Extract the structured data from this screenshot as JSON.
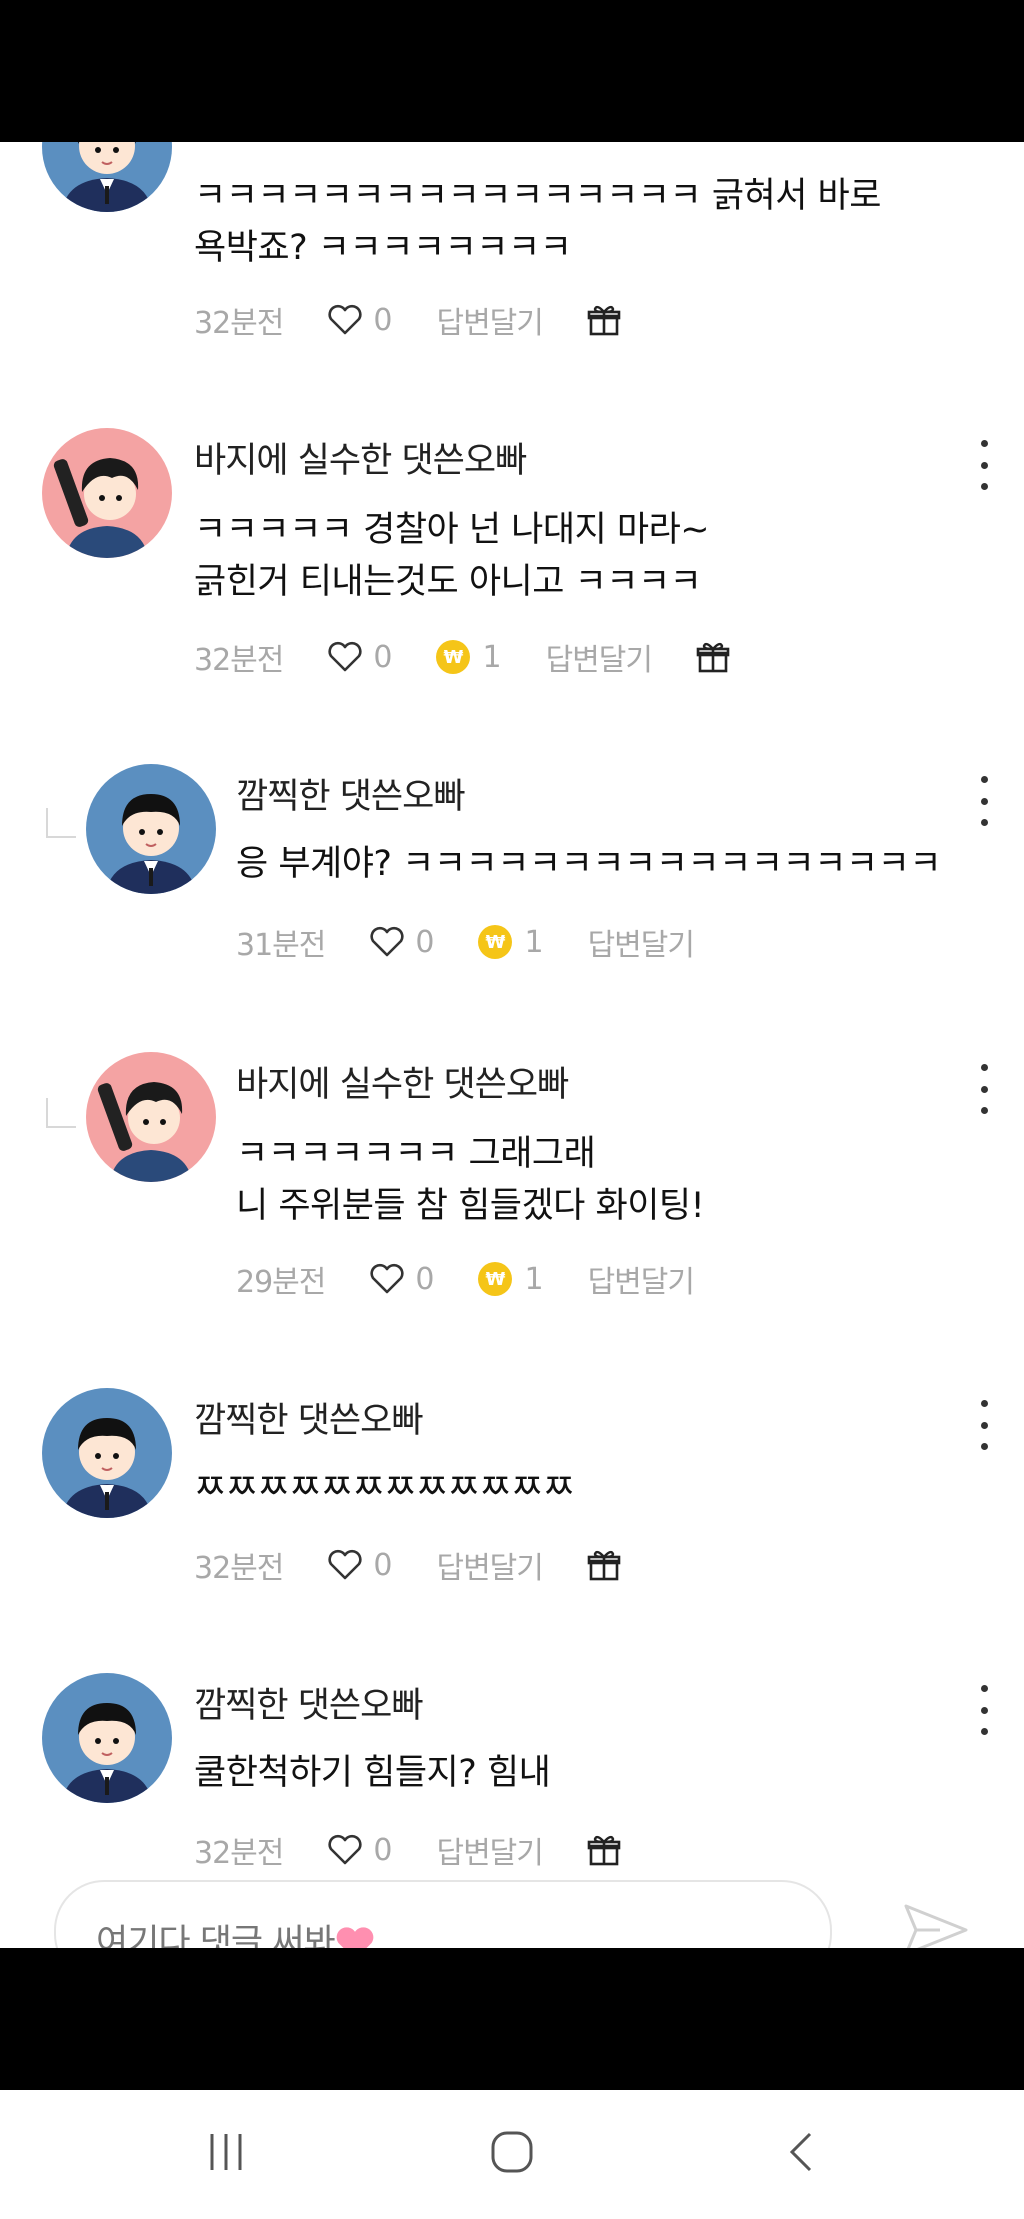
{
  "comments": [
    {
      "author": "",
      "lines": [
        "ㅋㅋㅋㅋㅋㅋㅋㅋㅋㅋㅋㅋㅋㅋㅋㅋ 긁혀서 바로",
        "욕박죠? ㅋㅋㅋㅋㅋㅋㅋㅋ"
      ],
      "time": "32분전",
      "likes": "0",
      "reply_label": "답변달기",
      "avatar": "blue-boy"
    },
    {
      "author": "바지에 실수한 댓쓴오빠",
      "lines": [
        "ㅋㅋㅋㅋㅋ 경찰아 넌 나대지 마라~",
        "긁힌거 티내는것도 아니고 ㅋㅋㅋㅋ"
      ],
      "time": "32분전",
      "likes": "0",
      "coins": "1",
      "reply_label": "답변달기",
      "avatar": "pink-boy"
    },
    {
      "author": "깜찍한 댓쓴오빠",
      "lines": [
        "응 부계야? ㅋㅋㅋㅋㅋㅋㅋㅋㅋㅋㅋㅋㅋㅋㅋㅋㅋ"
      ],
      "time": "31분전",
      "likes": "0",
      "coins": "1",
      "reply_label": "답변달기",
      "avatar": "blue-boy"
    },
    {
      "author": "바지에 실수한 댓쓴오빠",
      "lines": [
        "ㅋㅋㅋㅋㅋㅋㅋ 그래그래",
        "니 주위분들 참 힘들겠다 화이팅!"
      ],
      "time": "29분전",
      "likes": "0",
      "coins": "1",
      "reply_label": "답변달기",
      "avatar": "pink-boy"
    },
    {
      "author": "깜찍한 댓쓴오빠",
      "lines": [
        "ㅉㅉㅉㅉㅉㅉㅉㅉㅉㅉㅉㅉ"
      ],
      "time": "32분전",
      "likes": "0",
      "reply_label": "답변달기",
      "avatar": "blue-boy"
    },
    {
      "author": "깜찍한 댓쓴오빠",
      "lines": [
        "쿨한척하기 힘들지? 힘내"
      ],
      "time": "32분전",
      "likes": "0",
      "reply_label": "답변달기",
      "avatar": "blue-boy"
    }
  ],
  "input": {
    "placeholder": "여기다 댓글 써봐"
  },
  "icons": {
    "like": "heart-outline-icon",
    "coin": "won-coin-icon",
    "gift": "gift-icon",
    "more": "more-vertical-icon",
    "send": "send-icon",
    "nav": [
      "recent-apps-icon",
      "home-icon",
      "back-icon"
    ]
  },
  "colors": {
    "coin": "#f5c518",
    "meta_text": "#a8a8a8",
    "blue_avatar": "#5b8fc0",
    "pink_avatar": "#f4a3a3"
  }
}
